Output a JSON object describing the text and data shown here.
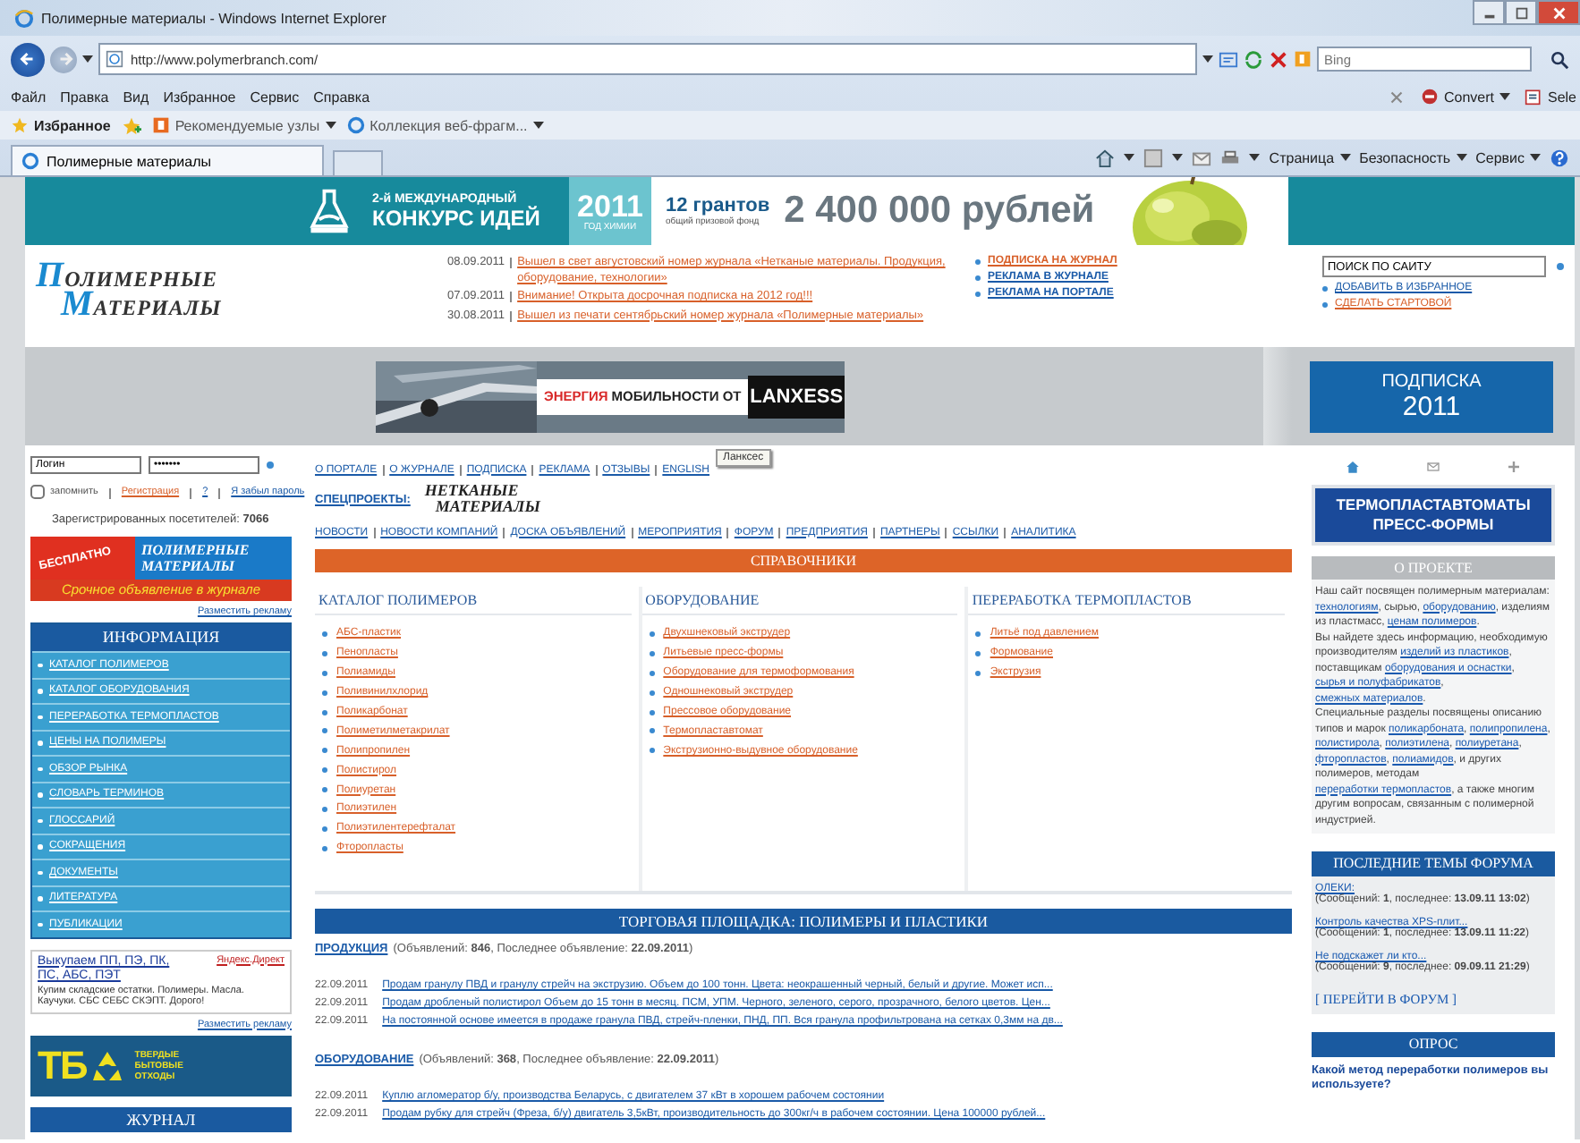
{
  "window": {
    "title": "Полимерные материалы - Windows Internet Explorer",
    "address": "http://www.polymerbranch.com/",
    "search_placeholder": "Bing",
    "menu": [
      "Файл",
      "Правка",
      "Вид",
      "Избранное",
      "Сервис",
      "Справка"
    ],
    "toolbar_right": [
      "Convert",
      "Sele"
    ],
    "favorites_label": "Избранное",
    "favorites": [
      "Рекомендуемые узлы",
      "Коллекция веб-фрагм..."
    ],
    "tab": "Полимерные материалы",
    "commands": [
      "Страница",
      "Безопасность",
      "Сервис"
    ]
  },
  "top_banner": {
    "subtitle": "2-й МЕЖДУНАРОДНЫЙ",
    "title": "КОНКУРС ИДЕЙ",
    "year": "2011",
    "year_caption": "ГОД ХИМИИ",
    "grants": "12 грантов",
    "fund_caption": "общий призовой фонд",
    "amount": "2 400 000 рублей"
  },
  "header": {
    "logo": [
      "ПОЛИМЕРНЫЕ",
      "МАТЕРИАЛЫ"
    ],
    "news": [
      {
        "date": "08.09.2011",
        "text": "Вышел в свет августовский номер журнала «Нетканые материалы. Продукция, оборудование, технологии»"
      },
      {
        "date": "07.09.2011",
        "text": "Внимание! Открыта досрочная подписка на 2012 год!!!"
      },
      {
        "date": "30.08.2011",
        "text": "Вышел из печати сентябрьский номер журнала «Полимерные материалы»"
      }
    ],
    "links": [
      "ПОДПИСКА НА ЖУРНАЛ",
      "РЕКЛАМА В ЖУРНАЛЕ",
      "РЕКЛАМА НА ПОРТАЛЕ"
    ],
    "search": {
      "value": "ПОИСК ПО САЙТУ"
    },
    "site_links": [
      "ДОБАВИТЬ В ИЗБРАННОЕ",
      "СДЕЛАТЬ СТАРТОВОЙ"
    ]
  },
  "ad_band": {
    "banner": [
      "ЭНЕРГИЯ",
      "МОБИЛЬНОСТИ ОТ",
      "LANXESS"
    ],
    "subscribe": [
      "ПОДПИСКА",
      "2011"
    ],
    "tooltip": "Ланксес"
  },
  "login": {
    "username": "Логин",
    "password": "•••••••",
    "remember": {
      "label": "запомнить",
      "checked": false
    },
    "links": [
      "Регистрация",
      "?",
      "Я забыл пароль"
    ]
  },
  "visitors": "Зарегистрированных посетителей: **7066**",
  "left_ad": {
    "lines": [
      "БЕСПЛАТНО",
      "ПОЛИМЕРНЫЕ",
      "МАТЕРИАЛЫ",
      "Срочное объявление в журнале"
    ],
    "link": "Разместить рекламу"
  },
  "info_menu": {
    "title": "ИНФОРМАЦИЯ",
    "items": [
      "КАТАЛОГ ПОЛИМЕРОВ",
      "КАТАЛОГ ОБОРУДОВАНИЯ",
      "ПЕРЕРАБОТКА ТЕРМОПЛАСТОВ",
      "ЦЕНЫ НА ПОЛИМЕРЫ",
      "ОБЗОР РЫНКА",
      "СЛОВАРЬ ТЕРМИНОВ",
      "ГЛОССАРИЙ",
      "СОКРАЩЕНИЯ",
      "ДОКУМЕНТЫ",
      "ЛИТЕРАТУРА",
      "ПУБЛИКАЦИИ"
    ]
  },
  "direct_ad": {
    "title": "Выкупаем ПП, ПЭ, ПК, ПС, АБС, ПЭТ",
    "source": "Яндекс.Директ",
    "text": "Купим складские остатки. Полимеры. Масла. Каучуки. СБС СЕБС СКЭПТ. Дорого!",
    "link": "Разместить рекламу"
  },
  "tbo_banner": {
    "big": "ТБ",
    "lines": [
      "ТВЕРДЫЕ",
      "БЫТОВЫЕ",
      "ОТХОДЫ"
    ]
  },
  "journal": {
    "title": "ЖУРНАЛ"
  },
  "top_links": [
    "О ПОРТАЛЕ",
    "О ЖУРНАЛЕ",
    "ПОДПИСКА",
    "РЕКЛАМА",
    "ОТЗЫВЫ",
    "ENGLISH"
  ],
  "special": {
    "label": "СПЕЦПРОЕКТЫ:",
    "logo": [
      "НЕТКАНЫЕ",
      "МАТЕРИАЛЫ"
    ]
  },
  "nav_links": [
    "НОВОСТИ",
    "НОВОСТИ КОМПАНИЙ",
    "ДОСКА ОБЪЯВЛЕНИЙ",
    "МЕРОПРИЯТИЯ",
    "ФОРУМ",
    "ПРЕДПРИЯТИЯ",
    "ПАРТНЕРЫ",
    "ССЫЛКИ",
    "АНАЛИТИКА"
  ],
  "directories": {
    "title": "СПРАВОЧНИКИ",
    "columns": [
      {
        "title": "КАТАЛОГ ПОЛИМЕРОВ",
        "items": [
          "АБС-пластик",
          "Пенопласты",
          "Полиамиды",
          "Поливинилхлорид",
          "Поликарбонат",
          "Полиметилметакрилат",
          "Полипропилен",
          "Полистирол",
          "Полиуретан",
          "Полиэтилен",
          "Полиэтилентерефталат",
          "Фторопласты"
        ]
      },
      {
        "title": "ОБОРУДОВАНИЕ",
        "items": [
          "Двухшнековый экструдер",
          "Литьевые пресс-формы",
          "Оборудование для термоформования",
          "Одношнековый экструдер",
          "Прессовое оборудование",
          "Термопластавтомат",
          "Экструзионно-выдувное оборудование"
        ]
      },
      {
        "title": "ПЕРЕРАБОТКА ТЕРМОПЛАСТОВ",
        "items": [
          "Литьё под давлением",
          "Формование",
          "Экструзия"
        ]
      }
    ]
  },
  "trade": {
    "title": "ТОРГОВАЯ ПЛОЩАДКА: ПОЛИМЕРЫ И ПЛАСТИКИ",
    "sections": [
      {
        "name": "ПРОДУКЦИЯ",
        "summary": "(Объявлений: **846**, Последнее объявление: **22.09.2011**)",
        "rows": [
          {
            "date": "22.09.2011",
            "text": "Продам гранулу ПВД и гранулу стрейч на экструзию. Объем до 100 тонн. Цвета: неокрашенный черный, белый и другие. Может исп..."
          },
          {
            "date": "22.09.2011",
            "text": "Продам дробленый полистирол Объем до 15 тонн в месяц. ПСМ, УПМ. Черного, зеленого, серого, прозрачного, белого цветов. Цен..."
          },
          {
            "date": "22.09.2011",
            "text": "На постоянной основе имеется в продаже гранула ПВД, стрейч-пленки, ПНД, ПП. Вся гранула профильтрована на сетках 0,3мм на дв..."
          }
        ]
      },
      {
        "name": "ОБОРУДОВАНИЕ",
        "summary": "(Объявлений: **368**, Последнее объявление: **22.09.2011**)",
        "rows": [
          {
            "date": "22.09.2011",
            "text": "Куплю агломератор б/у, производства Беларусь, с двигателем 37 кВт в хорошем рабочем состоянии"
          },
          {
            "date": "22.09.2011",
            "text": "Продам рубку для стрейч (Фреза, б/у) двигатель 3,5кВт, производительность до 300кг/ч в рабочем состоянии. Цена 100000 рублей..."
          }
        ]
      }
    ]
  },
  "promo": [
    "ТЕРМОПЛАСТАВТОМАТЫ",
    "ПРЕСС-ФОРМЫ"
  ],
  "about": {
    "title": "О ПРОЕКТЕ",
    "paragraphs": [
      [
        {
          "kind": "text",
          "text": "Наш сайт посвящен полимерным материалам: "
        },
        {
          "kind": "link",
          "text": "технологиям"
        },
        {
          "kind": "text",
          "text": ", сырью, "
        },
        {
          "kind": "link",
          "text": "оборудованию"
        },
        {
          "kind": "text",
          "text": ", изделиям из пластмасс, "
        },
        {
          "kind": "link",
          "text": "ценам полимеров"
        },
        {
          "kind": "text",
          "text": "."
        }
      ],
      [
        {
          "kind": "text",
          "text": "Вы найдете здесь информацию, необходимую производителям "
        },
        {
          "kind": "link",
          "text": "изделий из пластиков"
        },
        {
          "kind": "text",
          "text": ", поставщикам "
        },
        {
          "kind": "link",
          "text": "оборудования и оснастки"
        },
        {
          "kind": "text",
          "text": ", "
        },
        {
          "kind": "link",
          "text": "сырья и полуфабрикатов"
        },
        {
          "kind": "text",
          "text": ", "
        },
        {
          "kind": "link",
          "text": "смежных материалов"
        },
        {
          "kind": "text",
          "text": "."
        }
      ],
      [
        {
          "kind": "text",
          "text": "Специальные разделы посвящены описанию типов и марок "
        },
        {
          "kind": "link",
          "text": "поликарбоната"
        },
        {
          "kind": "text",
          "text": ", "
        },
        {
          "kind": "link",
          "text": "полипропилена"
        },
        {
          "kind": "text",
          "text": ", "
        },
        {
          "kind": "link",
          "text": "полистирола"
        },
        {
          "kind": "text",
          "text": ", "
        },
        {
          "kind": "link",
          "text": "полиэтилена"
        },
        {
          "kind": "text",
          "text": ", "
        },
        {
          "kind": "link",
          "text": "полиуретана"
        },
        {
          "kind": "text",
          "text": ", "
        },
        {
          "kind": "link",
          "text": "фторопластов"
        },
        {
          "kind": "text",
          "text": ", "
        },
        {
          "kind": "link",
          "text": "полиамидов"
        },
        {
          "kind": "text",
          "text": ", и других полимеров, методам "
        },
        {
          "kind": "link",
          "text": "переработки термопластов"
        },
        {
          "kind": "text",
          "text": ", а также многим другим вопросам, связанным с полимерной индустрией."
        }
      ]
    ]
  },
  "forum": {
    "title": "ПОСЛЕДНИЕ ТЕМЫ ФОРУМА",
    "topics": [
      {
        "title": "ОЛЕКИ:",
        "meta": "(Сообщений: **1**, последнее: **13.09.11 13:02**)"
      },
      {
        "title": "Контроль качества XPS-плит...",
        "meta": "(Сообщений: **1**, последнее: **13.09.11 11:22**)"
      },
      {
        "title": "Не подскажет ли кто...",
        "meta": "(Сообщений: **9**, последнее: **09.09.11 21:29**)"
      }
    ],
    "link": "[ ПЕРЕЙТИ В ФОРУМ ]"
  },
  "poll": {
    "title": "ОПРОС",
    "question": "Какой метод переработки полимеров вы используете?"
  }
}
